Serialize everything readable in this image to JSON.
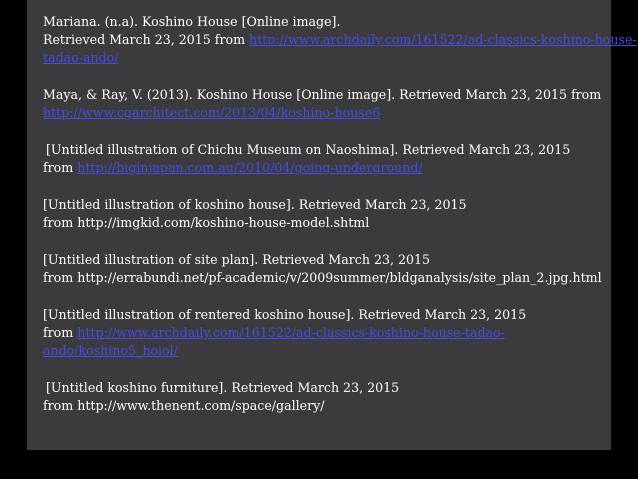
{
  "slide_title": "",
  "colors": {
    "background": "#000000",
    "panel": "#3b3b3e",
    "text": "#ffffff",
    "link": "#4a4ae8"
  },
  "references": [
    {
      "line1": "Mariana.  (n.a). Koshino House [Online image].",
      "line2_prefix": "Retrieved March 23, 2015 from ",
      "link_part1": "http://www.archdaily.com/161522/ad-classics-koshino-house-",
      "link_part2": "tadao-ando/"
    },
    {
      "line1": "Maya, & Ray, V.  (2013). Koshino House [Online image]. Retrieved March 23, 2015 from",
      "link": "http://www.cgarchitect.com/2013/04/koshino-house6"
    },
    {
      "line1": "[Untitled illustration of Chichu Museum on Naoshima]. Retrieved March 23, 2015",
      "line2_prefix": "from ",
      "link": "http://biginjapan.com.au/2010/04/going-underground/"
    },
    {
      "line1": "[Untitled illustration of koshino house]. Retrieved March 23, 2015",
      "line2": "from http://imgkid.com/koshino-house-model.shtml"
    },
    {
      "line1": "[Untitled illustration of site plan]. Retrieved March 23, 2015",
      "line2": "from http://errabundi.net/pf-academic/v/2009summer/bldganalysis/site_plan_2.jpg.html"
    },
    {
      "line1": "[Untitled illustration of rentered koshino house]. Retrieved March 23, 2015",
      "line2_prefix": "from ",
      "link_part1": "http://www.archdaily.com/161522/ad-classics-koshino-house-tadao-",
      "link_part2": "ando/koshino5_hoiol/"
    },
    {
      "line1": "[Untitled koshino furniture]. Retrieved March 23, 2015",
      "line2": "from http://www.thenent.com/space/gallery/"
    }
  ]
}
